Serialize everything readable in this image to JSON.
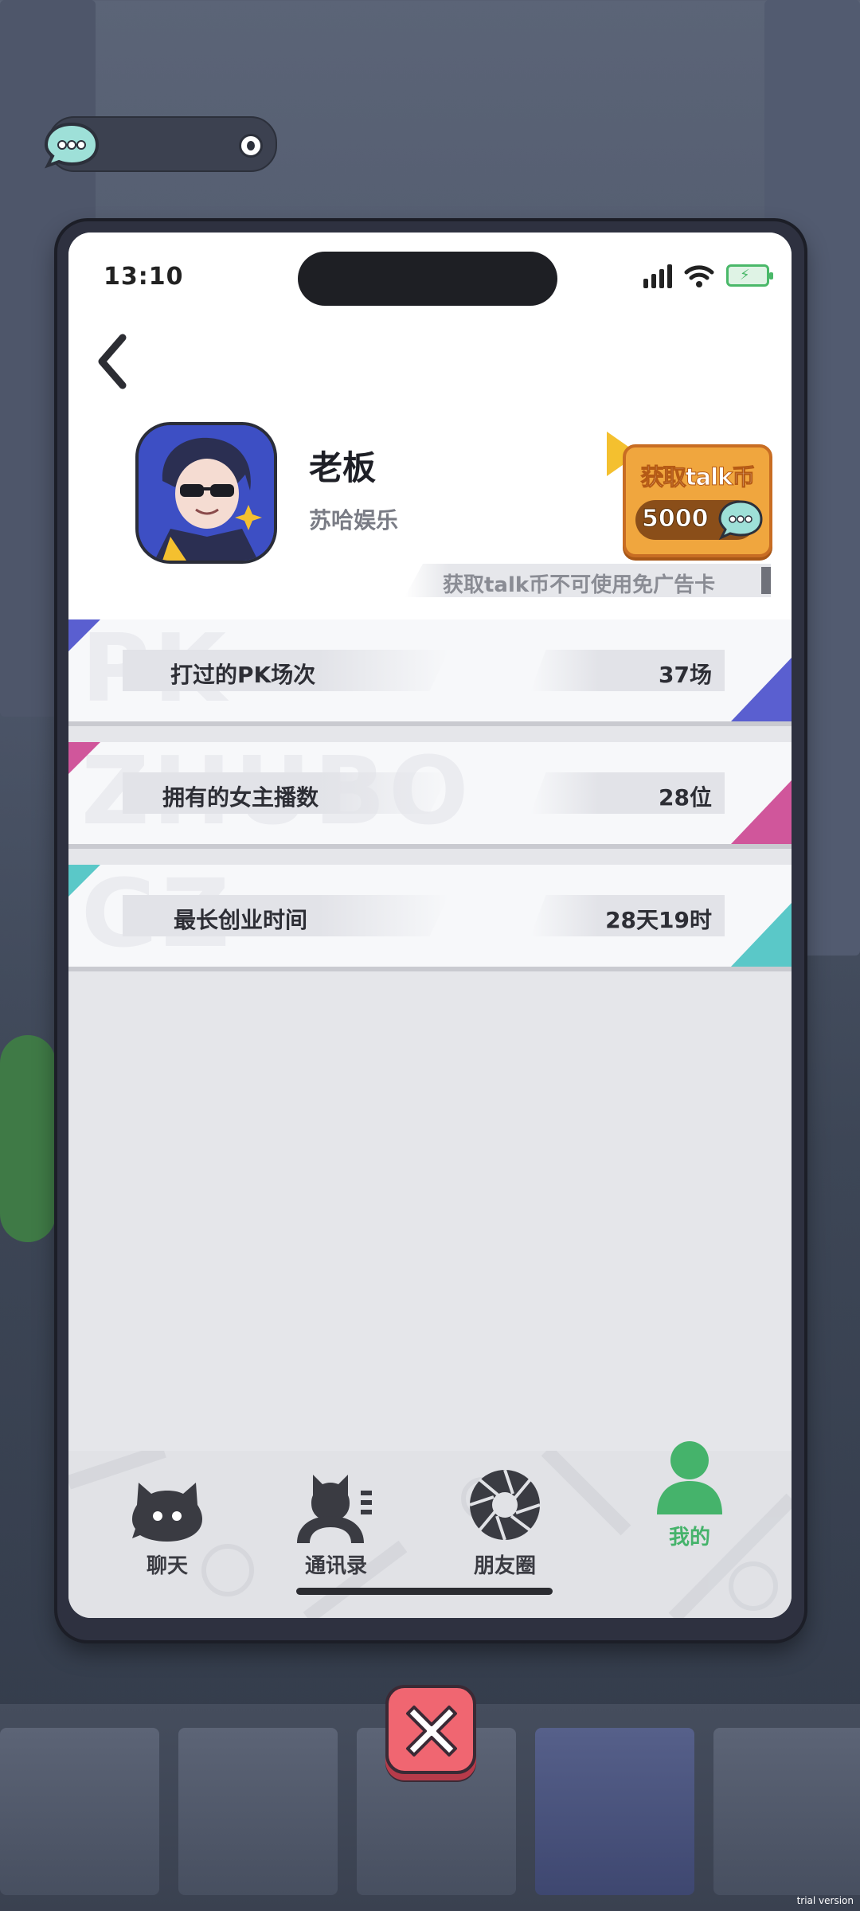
{
  "status_bar": {
    "time": "13:10"
  },
  "profile": {
    "name": "老板",
    "company": "苏哈娱乐"
  },
  "talk_coin": {
    "label": "获取talk币",
    "amount": "5000"
  },
  "notice": "获取talk币不可使用免广告卡",
  "stats": [
    {
      "watermark": "PK",
      "label": "打过的PK场次",
      "value": "37场",
      "accent": "#5a5fd0"
    },
    {
      "watermark": "ZHUBO",
      "label": "拥有的女主播数",
      "value": "28位",
      "accent": "#d0569b"
    },
    {
      "watermark": "GZ",
      "label": "最长创业时间",
      "value": "28天19时",
      "accent": "#5ac8c8"
    }
  ],
  "bottom_nav": {
    "chat": "聊天",
    "contacts": "通讯录",
    "moments": "朋友圈",
    "me": "我的"
  },
  "active_color": "#45b36b",
  "watermark_text": "trial version"
}
